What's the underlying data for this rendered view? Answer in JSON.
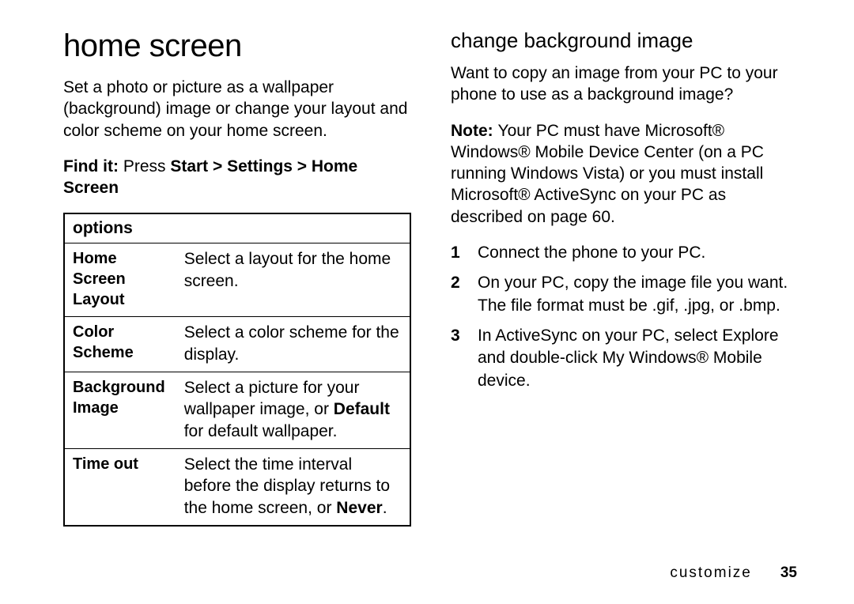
{
  "left": {
    "heading": "home screen",
    "intro": "Set a photo or picture as a wallpaper (background) image or change your layout and color scheme on your home screen.",
    "findit_label": "Find it: ",
    "findit_prefix": "Press ",
    "findit_path": "Start > Settings > Home Screen",
    "table": {
      "header": "options",
      "rows": [
        {
          "opt": "Home Screen Layout",
          "desc_pre": "Select a layout for the home screen.",
          "desc_bold": "",
          "desc_post": ""
        },
        {
          "opt": "Color Scheme",
          "desc_pre": "Select a color scheme for the display.",
          "desc_bold": "",
          "desc_post": ""
        },
        {
          "opt": "Background Image",
          "desc_pre": "Select a picture for your wallpaper image, or ",
          "desc_bold": "Default",
          "desc_post": " for default wallpaper."
        },
        {
          "opt": "Time out",
          "desc_pre": "Select the time interval before the display returns to the home screen, or ",
          "desc_bold": "Never",
          "desc_post": "."
        }
      ]
    }
  },
  "right": {
    "heading": "change background image",
    "intro": "Want to copy an image from your PC to your phone to use as a background image?",
    "note_label": "Note: ",
    "note_body": "Your PC must have Microsoft® Windows® Mobile Device Center (on a PC running Windows Vista) or you must install Microsoft® ActiveSync on your PC as described on page 60.",
    "steps": [
      "Connect the phone to your PC.",
      "On your PC, copy the image file you want. The file format must be .gif, .jpg, or .bmp.",
      "In ActiveSync on your PC, select Explore and double-click My Windows® Mobile device."
    ]
  },
  "footer": {
    "section": "customize",
    "page": "35"
  }
}
